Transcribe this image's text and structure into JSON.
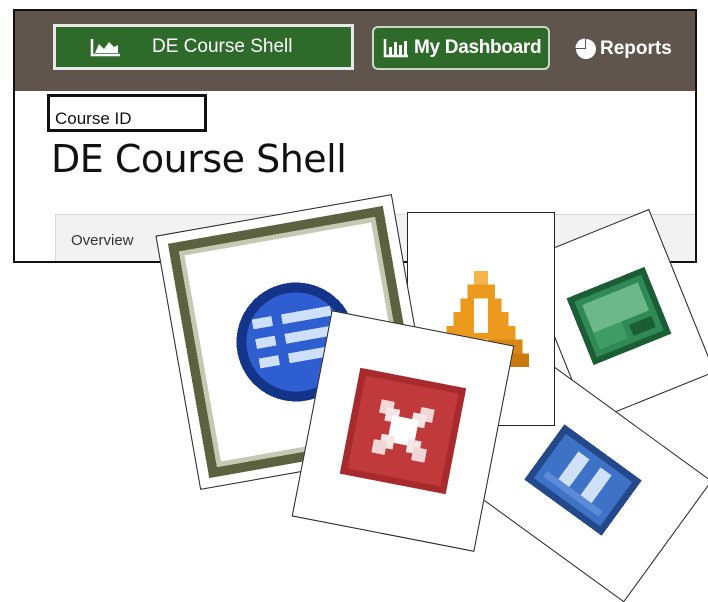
{
  "topbar": {
    "course_button_label": "DE Course Shell",
    "course_button_icon": "area-chart-icon",
    "dashboard_label": "My Dashboard",
    "dashboard_icon": "bar-chart-icon",
    "reports_label": "Reports",
    "reports_icon": "pie-chart-icon"
  },
  "header": {
    "course_id_label": "Course ID",
    "course_title": "DE Course Shell"
  },
  "tabs": [
    {
      "label": "Overview"
    }
  ],
  "cards": [
    {
      "icon": "calendar-list-icon"
    },
    {
      "icon": "warning-icon"
    },
    {
      "icon": "green-document-icon"
    },
    {
      "icon": "blue-edit-icon"
    },
    {
      "icon": "red-x-icon"
    }
  ],
  "colors": {
    "topbar_bg": "#5f554c",
    "course_button_bg": "#2e6b2a",
    "error_red": "#c0393b",
    "warning_orange": "#ec9a1e",
    "success_green": "#2f8a55",
    "info_blue": "#2e62b8"
  }
}
